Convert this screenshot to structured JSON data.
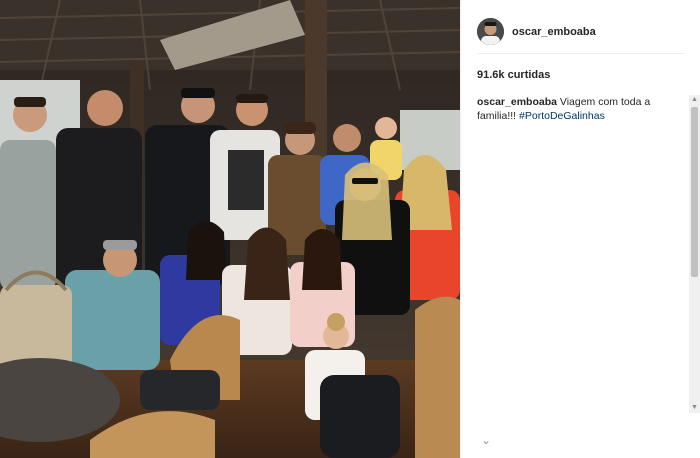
{
  "post": {
    "username": "oscar_emboaba",
    "likes": "91.6k curtidas",
    "caption": {
      "username": "oscar_emboaba",
      "text": "Viagem com toda a familia!!!",
      "hashtag": "#PortoDeGalinhas"
    }
  },
  "icons": {
    "more": "chevron-down-icon",
    "scroll_up": "arrow-up-icon",
    "scroll_down": "arrow-down-icon"
  }
}
